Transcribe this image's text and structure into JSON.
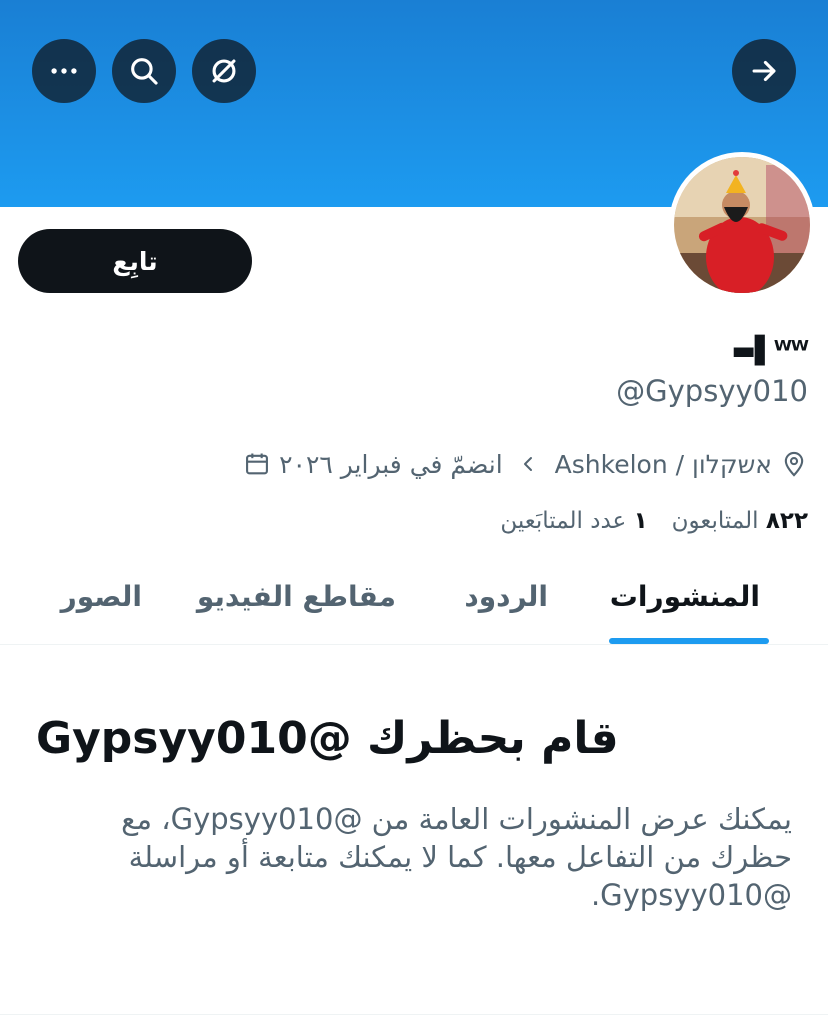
{
  "header": {
    "back_icon": "arrow-right-icon",
    "more_icon": "more-horizontal-icon",
    "search_icon": "search-icon",
    "grok_icon": "grok-icon",
    "banner_color": "#1d9bf0"
  },
  "profile": {
    "display_name": "▬▌ᵂᵂ",
    "handle": "@Gypsyy010",
    "follow_label": "تابِع",
    "location": "אשקלון / Ashkelon",
    "joined": "انضمّ في فبراير ٢٠٢٦",
    "stats": {
      "following_count": "١",
      "following_label": "عدد المتابَعين",
      "followers_count": "٨٢٢",
      "followers_label": "المتابعون"
    }
  },
  "tabs": {
    "posts": "المنشورات",
    "replies": "الردود",
    "videos": "مقاطع الفيديو",
    "photos": "الصور",
    "accent": "#1d9bf0"
  },
  "blocked": {
    "title": "قام بحظرك @Gypsyy010",
    "description": "يمكنك عرض المنشورات العامة من @Gypsyy010، مع حظرك من التفاعل معها. كما لا يمكنك متابعة أو مراسلة @Gypsyy010."
  }
}
